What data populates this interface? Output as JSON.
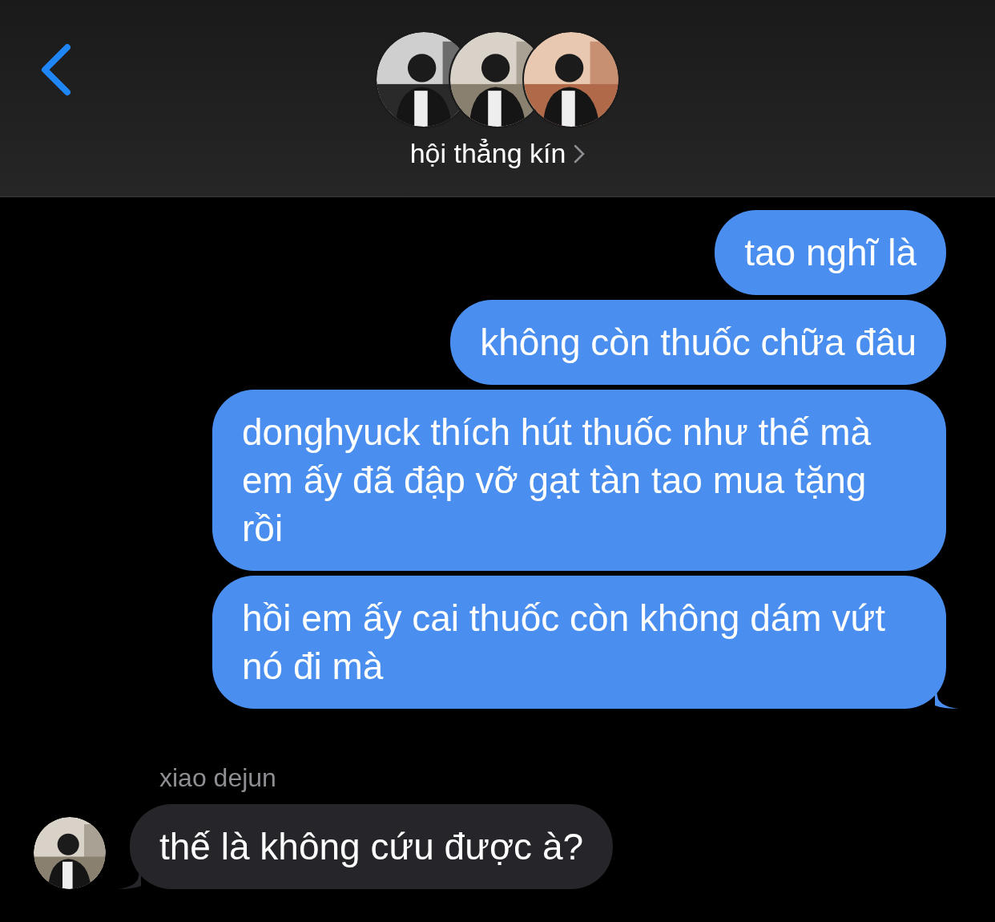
{
  "header": {
    "title": "hội thẳng kín"
  },
  "messages": [
    {
      "kind": "sent",
      "text": "tao nghĩ là",
      "tail": false
    },
    {
      "kind": "sent",
      "text": "không còn thuốc chữa đâu",
      "tail": false
    },
    {
      "kind": "sent",
      "text": "donghyuck thích hút thuốc như thế mà em ấy đã đập vỡ gạt tàn tao mua tặng rồi",
      "tail": false
    },
    {
      "kind": "sent",
      "text": "hồi em ấy cai thuốc còn không dám vứt nó đi mà",
      "tail": true
    },
    {
      "kind": "received",
      "sender": "xiao dejun",
      "text": "thế là không cứu được à?",
      "tail": true
    }
  ]
}
